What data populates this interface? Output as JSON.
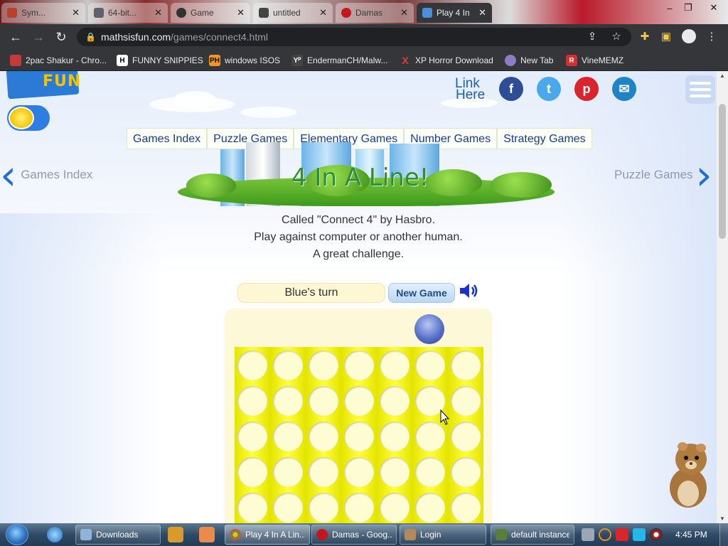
{
  "browser": {
    "tabs": [
      {
        "title": "Sym...",
        "favicon_color": "#b7402e"
      },
      {
        "title": "64-bit...",
        "favicon_color": "#5f6368"
      },
      {
        "title": "Game",
        "favicon_color": "#333333"
      },
      {
        "title": "untitled",
        "favicon_color": "#444444"
      },
      {
        "title": "Damas",
        "favicon_color": "#c4161c"
      },
      {
        "title": "Play 4 In",
        "favicon_color": "#4a90d9",
        "active": true
      }
    ],
    "new_tab_glyph": "+",
    "window_controls": {
      "minimize": "–",
      "maximize": "❐",
      "close": "✕"
    },
    "url": {
      "domain": "mathsisfun.com",
      "path": "/games/connect4.html"
    },
    "bookmarks": [
      {
        "label": "2pac Shakur - Chro...",
        "icon": "color-palette-icon",
        "icon_text": "",
        "color": "#c83a3a"
      },
      {
        "label": "FUNNY SNIPPIES",
        "icon": "h-logo-icon",
        "icon_text": "H",
        "color": "#ffffff"
      },
      {
        "label": "windows ISOS",
        "icon": "ph-logo-icon",
        "icon_text": "PH",
        "color": "#f7971d"
      },
      {
        "label": "EndermanCH/Malw...",
        "icon": "yp-logo-icon",
        "icon_text": "Yᴾ",
        "color": "#444444"
      },
      {
        "label": "XP Horror Download",
        "icon": "x-logo-icon",
        "icon_text": "X",
        "color": "#e53935"
      },
      {
        "label": "New Tab",
        "icon": "globe-icon",
        "icon_text": "",
        "color": "#8e7cc3"
      },
      {
        "label": "VineMEMZ",
        "icon": "r-logo-icon",
        "icon_text": "R",
        "color": "#d32f2f"
      }
    ]
  },
  "page": {
    "logo_text": "FUN",
    "link_here": {
      "line1": "Link",
      "line2": "Here"
    },
    "social": [
      {
        "name": "facebook-icon",
        "glyph": "f",
        "color": "#2d4e94"
      },
      {
        "name": "twitter-icon",
        "glyph": "t",
        "color": "#4aa8ec"
      },
      {
        "name": "pinterest-icon",
        "glyph": "p",
        "color": "#d9242e"
      },
      {
        "name": "email-icon",
        "glyph": "✉",
        "color": "#1f84c6"
      }
    ],
    "categories": [
      "Games Index",
      "Puzzle Games",
      "Elementary Games",
      "Number Games",
      "Strategy Games"
    ],
    "title": "4 In A Line!",
    "prev_link": "Games Index",
    "next_link": "Puzzle Games",
    "description": [
      "Called \"Connect 4\" by Hasbro.",
      "Play against computer or another human.",
      "A great challenge."
    ]
  },
  "game": {
    "status": "Blue's turn",
    "new_game_label": "New Game",
    "current_player": "blue",
    "columns": 7,
    "visible_rows": 5
  },
  "taskbar": {
    "buttons": [
      {
        "label": "Downloads",
        "icon_color": "#8fb3d9"
      },
      {
        "label": "Play 4 In A Lin...",
        "icon_color": "#4a90d9",
        "active": true
      },
      {
        "label": "Damas - Goog...",
        "icon_color": "#c4161c"
      },
      {
        "label": "Login",
        "icon_color": "#b08a5a"
      },
      {
        "label": "default instance",
        "icon_color": "#5a7d3a"
      }
    ],
    "clock": "4:45 PM"
  }
}
